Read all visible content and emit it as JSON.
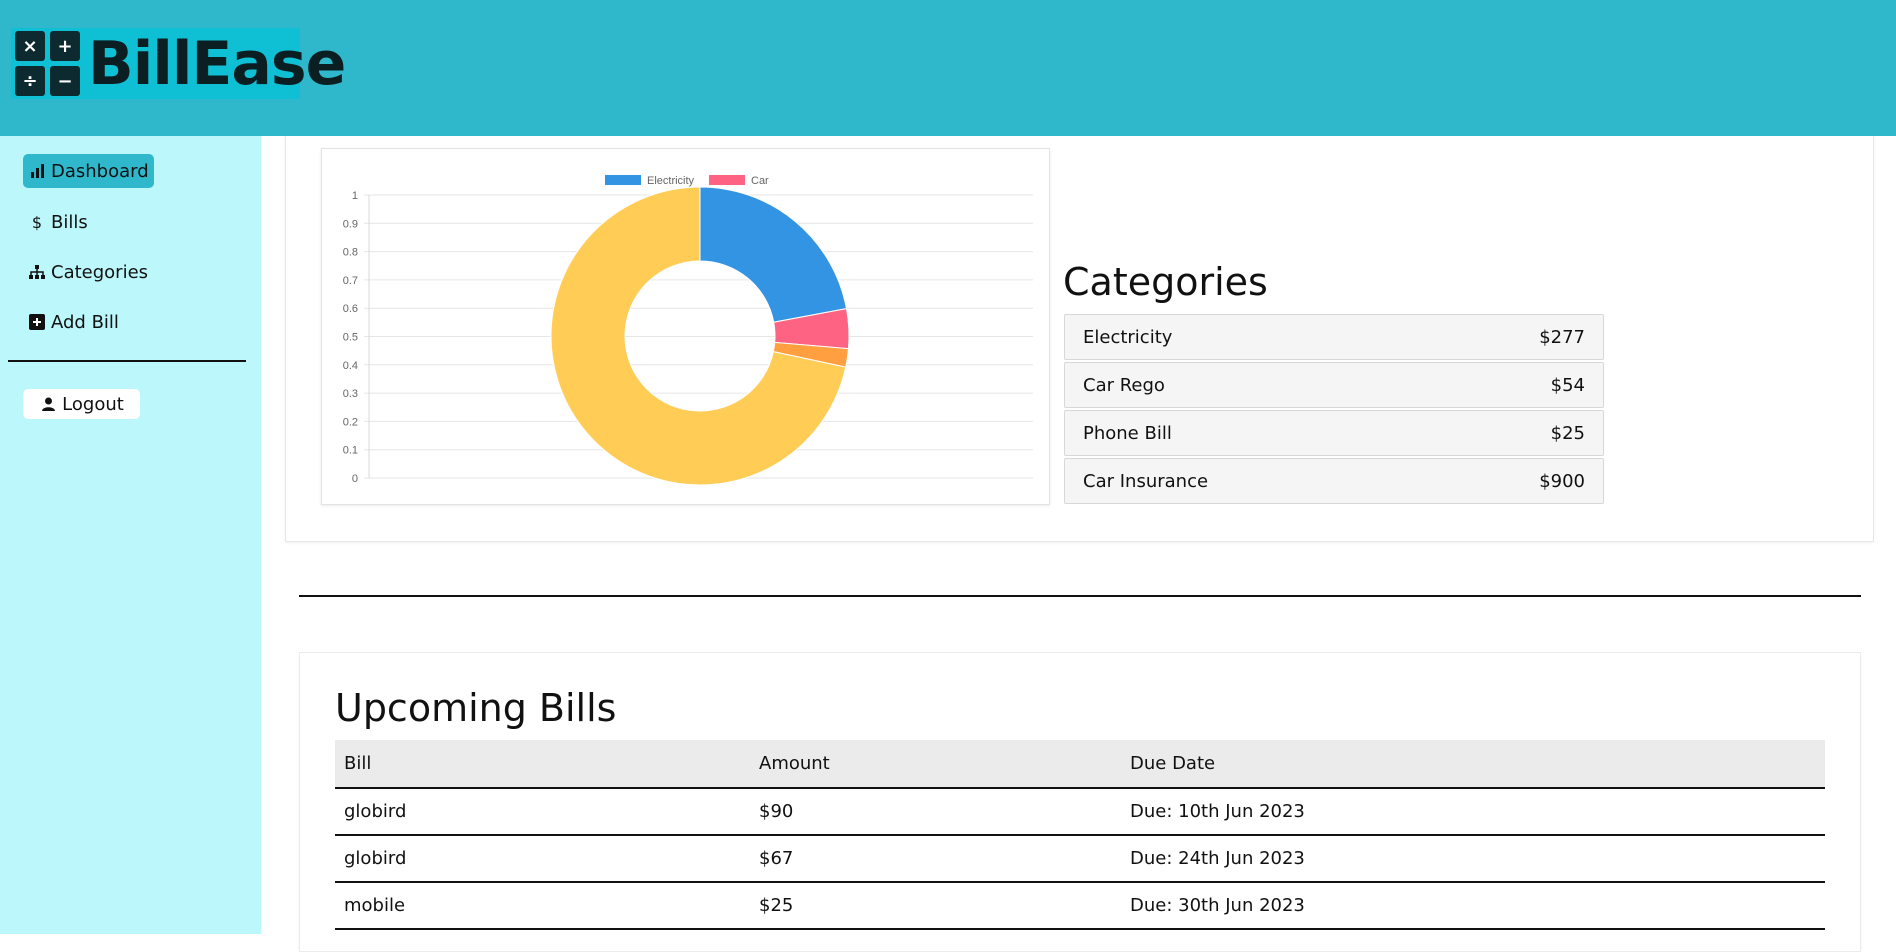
{
  "app": {
    "logo_text": "BillEase",
    "logo_symbols": [
      "×",
      "+",
      "÷",
      "−"
    ]
  },
  "sidebar": {
    "items": [
      {
        "label": "Dashboard",
        "icon": "bar-chart-icon",
        "active": true
      },
      {
        "label": "Bills",
        "icon": "dollar-icon",
        "active": false
      },
      {
        "label": "Categories",
        "icon": "sitemap-icon",
        "active": false
      },
      {
        "label": "Add Bill",
        "icon": "plus-square-icon",
        "active": false
      }
    ],
    "logout_label": "Logout"
  },
  "chart_data": {
    "type": "pie",
    "legend": [
      "Electricity",
      "Car"
    ],
    "legend_position": "top",
    "y_ticks": [
      "1",
      "0.9",
      "0.8",
      "0.7",
      "0.6",
      "0.5",
      "0.4",
      "0.3",
      "0.2",
      "0.1",
      "0"
    ],
    "slices": [
      {
        "label": "Electricity",
        "value": 277,
        "color": "#3394e4"
      },
      {
        "label": "Car Rego",
        "value": 54,
        "color": "#ff6384"
      },
      {
        "label": "Phone Bill",
        "value": 25,
        "color": "#ff9f40"
      },
      {
        "label": "Car Insurance",
        "value": 900,
        "color": "#ffcd56"
      }
    ]
  },
  "categories": {
    "title": "Categories",
    "rows": [
      {
        "name": "Electricity",
        "amount": "$277"
      },
      {
        "name": "Car Rego",
        "amount": "$54"
      },
      {
        "name": "Phone Bill",
        "amount": "$25"
      },
      {
        "name": "Car Insurance",
        "amount": "$900"
      }
    ]
  },
  "upcoming": {
    "title": "Upcoming Bills",
    "headers": [
      "Bill",
      "Amount",
      "Due Date"
    ],
    "rows": [
      [
        "globird",
        "$90",
        "Due: 10th Jun 2023"
      ],
      [
        "globird",
        "$67",
        "Due: 24th Jun 2023"
      ],
      [
        "mobile",
        "$25",
        "Due: 30th Jun 2023"
      ]
    ]
  }
}
